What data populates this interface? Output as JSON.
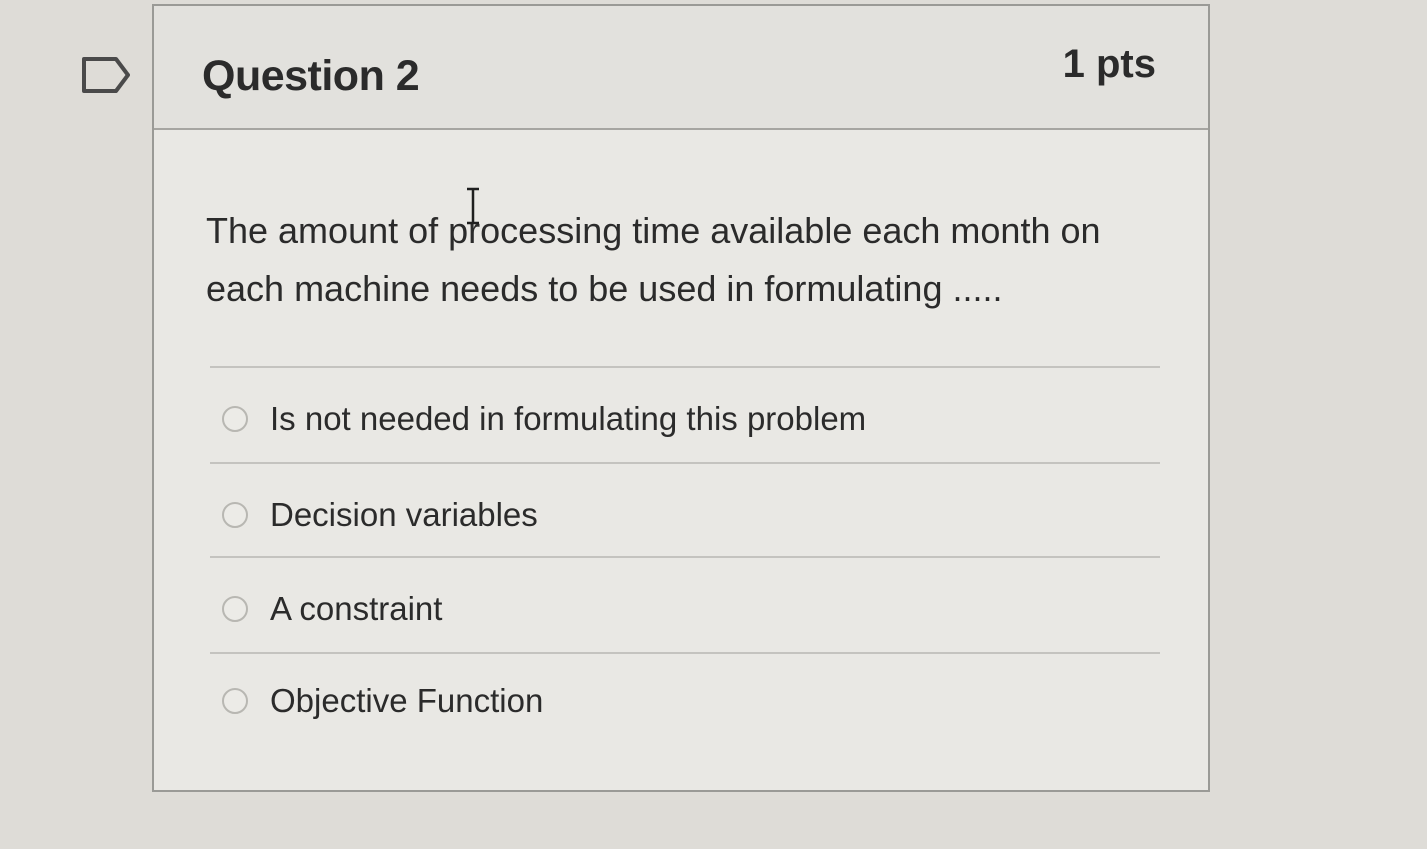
{
  "question": {
    "title": "Question 2",
    "points": "1 pts",
    "text": "The amount of processing time available each month on each machine needs to be used in formulating .....",
    "flag_icon": "flag-outline-icon",
    "answers": [
      {
        "label": "Is not needed in formulating this problem",
        "selected": false
      },
      {
        "label": "Decision variables",
        "selected": false
      },
      {
        "label": "A constraint",
        "selected": false
      },
      {
        "label": "Objective Function",
        "selected": false
      }
    ]
  },
  "colors": {
    "background": "#dedcd7",
    "card": "#e9e8e4",
    "header": "#e2e1dd",
    "text": "#2b2b2b",
    "border": "#9a9a96"
  }
}
